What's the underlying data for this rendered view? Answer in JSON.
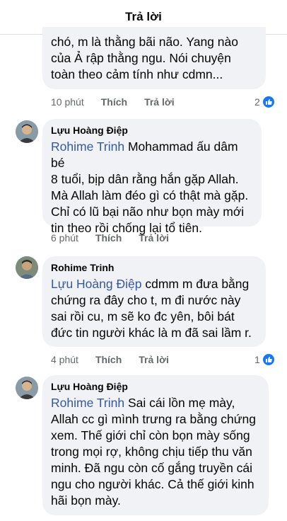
{
  "header": {
    "title": "Trả lời"
  },
  "comments": [
    {
      "author": "",
      "lines": [
        "chó, m là thằng bãi não. Yang nào",
        "của Ả rập thằng ngu. Nói chuyện",
        "toàn theo cảm tính như cdmn..."
      ],
      "time": "10 phút",
      "like_label": "Thích",
      "reply_label": "Trả lời",
      "reaction_count": "2"
    },
    {
      "author": "Lựu Hoàng Điệp",
      "mention": "Rohime Trinh",
      "lines": [
        " Mohammad ấu dâm bé",
        "8 tuổi, bịp dân rằng hắn gặp Allah.",
        "Mà Allah làm đéo gì có thật mà gặp.",
        "Chỉ có lũ bại não như bọn mày mới",
        "tin theo rồi chống lại tổ tiên."
      ],
      "time": "6 phút",
      "like_label": "Thích",
      "reply_label": "Trả lời"
    },
    {
      "author": "Rohime Trinh",
      "mention": "Lựu Hoàng Điệp",
      "lines": [
        " cdmm m đưa bằng",
        "chứng ra đây cho t, m đi nước này",
        "sai rồi cu, m sẽ ko đc yên, bôi bát",
        "đức tin người khác là m đã sai lầm r."
      ],
      "time": "4 phút",
      "like_label": "Thích",
      "reply_label": "Trả lời",
      "reaction_count": "1"
    },
    {
      "author": "Lựu Hoàng Điệp",
      "mention": "Rohime Trinh",
      "lines": [
        " Sai cái lồn mẹ mày,",
        "Allah cc gì mình trưng ra bằng chứng",
        "xem. Thế giới chỉ còn bọn mày sống",
        "trong mọi rợ, không chịu tiếp thu văn",
        "minh. Đã ngu còn cố gắng truyền cái",
        "ngu cho người khác. Cả thế giới kinh",
        "hãi bọn mày."
      ]
    }
  ]
}
